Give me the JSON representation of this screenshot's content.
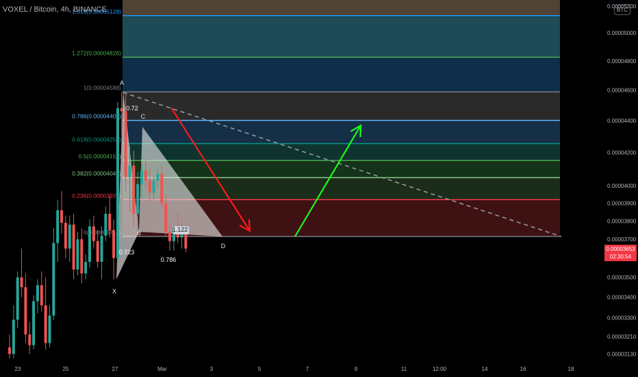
{
  "header": {
    "symbol_title": "VOXEL / Bitcoin, 4h, BINANCE",
    "currency_badge": "BTC"
  },
  "price_tag": {
    "price": "0.00003653",
    "countdown": "02:30:54",
    "color": "#f23645"
  },
  "chart_data": {
    "type": "candlestick",
    "x_ticks": [
      "23",
      "25",
      "27",
      "Mar",
      "3",
      "5",
      "7",
      "9",
      "11",
      "12:00",
      "14",
      "16",
      "18"
    ],
    "y_ticks": [
      "0.00005200",
      "0.00005000",
      "0.00004800",
      "0.00004600",
      "0.00004400",
      "0.00004200",
      "0.00004000",
      "0.00003900",
      "0.00003800",
      "0.00003700",
      "0.00003600",
      "0.00003500",
      "0.00003400",
      "0.00003300",
      "0.00003210",
      "0.00003130"
    ],
    "y_scale": "log",
    "current_price": 3.653e-05,
    "colors": {
      "up": "#26a69a",
      "down": "#ef5350"
    },
    "fib_levels": [
      {
        "label": "1.618(0.00005128)",
        "price": 5.128e-05,
        "color": "#2196f3"
      },
      {
        "label": "1.272(0.00004826)",
        "price": 4.826e-05,
        "color": "#4caf50"
      },
      {
        "label": "1(0.00004588)",
        "price": 4.588e-05,
        "color": "#787b86"
      },
      {
        "label": "0.786(0.00004401)",
        "price": 4.401e-05,
        "color": "#64b5f6"
      },
      {
        "label": "0.618(0.00004254)",
        "price": 4.254e-05,
        "color": "#089981"
      },
      {
        "label": "0.5(0.00004151)",
        "price": 4.151e-05,
        "color": "#4caf50"
      },
      {
        "label": "0.382(0.00004048)",
        "price": 4.048e-05,
        "color": "#81c784"
      },
      {
        "label": "0.236(0.00003920)",
        "price": 3.92e-05,
        "color": "#f23645"
      },
      {
        "label": "0(0.00003715)",
        "price": 3.715e-05,
        "color": "#787b86"
      }
    ],
    "pattern_points": [
      {
        "label": "X",
        "price": 3.49e-05
      },
      {
        "label": "A",
        "price": 4.588e-05
      },
      {
        "label": "B",
        "price": 3.74e-05
      },
      {
        "label": "C",
        "price": 4.36e-05
      },
      {
        "label": "D",
        "price": 3.715e-05
      }
    ],
    "pattern_ratios": [
      "0.72",
      "0.723",
      "0.786",
      "1.122"
    ],
    "candles": [
      {
        "o": 3.16e-05,
        "h": 3.22e-05,
        "l": 3.11e-05,
        "c": 3.13e-05
      },
      {
        "o": 3.13e-05,
        "h": 3.36e-05,
        "l": 3.11e-05,
        "c": 3.29e-05
      },
      {
        "o": 3.29e-05,
        "h": 3.53e-05,
        "l": 3.25e-05,
        "c": 3.5e-05
      },
      {
        "o": 3.5e-05,
        "h": 3.65e-05,
        "l": 3.4e-05,
        "c": 3.45e-05
      },
      {
        "o": 3.45e-05,
        "h": 3.52e-05,
        "l": 3.18e-05,
        "c": 3.22e-05
      },
      {
        "o": 3.22e-05,
        "h": 3.28e-05,
        "l": 3.13e-05,
        "c": 3.17e-05
      },
      {
        "o": 3.17e-05,
        "h": 3.41e-05,
        "l": 3.15e-05,
        "c": 3.38e-05
      },
      {
        "o": 3.38e-05,
        "h": 3.49e-05,
        "l": 3.32e-05,
        "c": 3.46e-05
      },
      {
        "o": 3.46e-05,
        "h": 3.53e-05,
        "l": 3.33e-05,
        "c": 3.36e-05
      },
      {
        "o": 3.36e-05,
        "h": 3.5e-05,
        "l": 3.15e-05,
        "c": 3.18e-05
      },
      {
        "o": 3.18e-05,
        "h": 3.36e-05,
        "l": 3.16e-05,
        "c": 3.31e-05
      },
      {
        "o": 3.31e-05,
        "h": 3.76e-05,
        "l": 3.29e-05,
        "c": 3.68e-05
      },
      {
        "o": 3.68e-05,
        "h": 3.92e-05,
        "l": 3.58e-05,
        "c": 3.86e-05
      },
      {
        "o": 3.86e-05,
        "h": 3.97e-05,
        "l": 3.73e-05,
        "c": 3.79e-05
      },
      {
        "o": 3.79e-05,
        "h": 3.83e-05,
        "l": 3.6e-05,
        "c": 3.65e-05
      },
      {
        "o": 3.65e-05,
        "h": 3.83e-05,
        "l": 3.58e-05,
        "c": 3.78e-05
      },
      {
        "o": 3.78e-05,
        "h": 3.84e-05,
        "l": 3.49e-05,
        "c": 3.54e-05
      },
      {
        "o": 3.54e-05,
        "h": 3.74e-05,
        "l": 3.51e-05,
        "c": 3.7e-05
      },
      {
        "o": 3.7e-05,
        "h": 3.76e-05,
        "l": 3.47e-05,
        "c": 3.52e-05
      },
      {
        "o": 3.52e-05,
        "h": 3.62e-05,
        "l": 3.49e-05,
        "c": 3.58e-05
      },
      {
        "o": 3.58e-05,
        "h": 3.81e-05,
        "l": 3.55e-05,
        "c": 3.77e-05
      },
      {
        "o": 3.77e-05,
        "h": 3.83e-05,
        "l": 3.65e-05,
        "c": 3.69e-05
      },
      {
        "o": 3.69e-05,
        "h": 3.75e-05,
        "l": 3.55e-05,
        "c": 3.58e-05
      },
      {
        "o": 3.58e-05,
        "h": 3.77e-05,
        "l": 3.49e-05,
        "c": 3.72e-05
      },
      {
        "o": 3.72e-05,
        "h": 3.88e-05,
        "l": 3.69e-05,
        "c": 3.84e-05
      },
      {
        "o": 3.84e-05,
        "h": 3.94e-05,
        "l": 3.71e-05,
        "c": 3.75e-05
      },
      {
        "o": 3.75e-05,
        "h": 3.81e-05,
        "l": 3.49e-05,
        "c": 3.6e-05
      },
      {
        "o": 3.6e-05,
        "h": 4.52e-05,
        "l": 3.58e-05,
        "c": 4.48e-05
      },
      {
        "o": 4.48e-05,
        "h": 4.59e-05,
        "l": 4.3e-05,
        "c": 4.46e-05
      },
      {
        "o": 4.46e-05,
        "h": 4.57e-05,
        "l": 3.97e-05,
        "c": 4.05e-05
      },
      {
        "o": 4.05e-05,
        "h": 4.24e-05,
        "l": 3.85e-05,
        "c": 4.12e-05
      },
      {
        "o": 4.12e-05,
        "h": 4.21e-05,
        "l": 3.77e-05,
        "c": 3.84e-05
      },
      {
        "o": 3.84e-05,
        "h": 4.08e-05,
        "l": 3.74e-05,
        "c": 4.01e-05
      },
      {
        "o": 4.01e-05,
        "h": 4.13e-05,
        "l": 3.93e-05,
        "c": 4.09e-05
      },
      {
        "o": 4.09e-05,
        "h": 4.16e-05,
        "l": 3.98e-05,
        "c": 4.03e-05
      },
      {
        "o": 4.03e-05,
        "h": 4.1e-05,
        "l": 3.91e-05,
        "c": 3.96e-05
      },
      {
        "o": 3.96e-05,
        "h": 4.06e-05,
        "l": 3.92e-05,
        "c": 4.03e-05
      },
      {
        "o": 4.03e-05,
        "h": 4.1e-05,
        "l": 3.99e-05,
        "c": 4.07e-05
      },
      {
        "o": 4.07e-05,
        "h": 4.12e-05,
        "l": 3.87e-05,
        "c": 3.9e-05
      },
      {
        "o": 3.9e-05,
        "h": 3.95e-05,
        "l": 3.72e-05,
        "c": 3.74e-05
      },
      {
        "o": 3.74e-05,
        "h": 3.78e-05,
        "l": 3.64e-05,
        "c": 3.69e-05
      },
      {
        "o": 3.69e-05,
        "h": 3.78e-05,
        "l": 3.64e-05,
        "c": 3.76e-05
      },
      {
        "o": 3.76e-05,
        "h": 3.85e-05,
        "l": 3.68e-05,
        "c": 3.71e-05
      },
      {
        "o": 3.71e-05,
        "h": 3.79e-05,
        "l": 3.65e-05,
        "c": 3.73e-05
      },
      {
        "o": 3.73e-05,
        "h": 3.77e-05,
        "l": 3.63e-05,
        "c": 3.65e-05
      }
    ]
  }
}
